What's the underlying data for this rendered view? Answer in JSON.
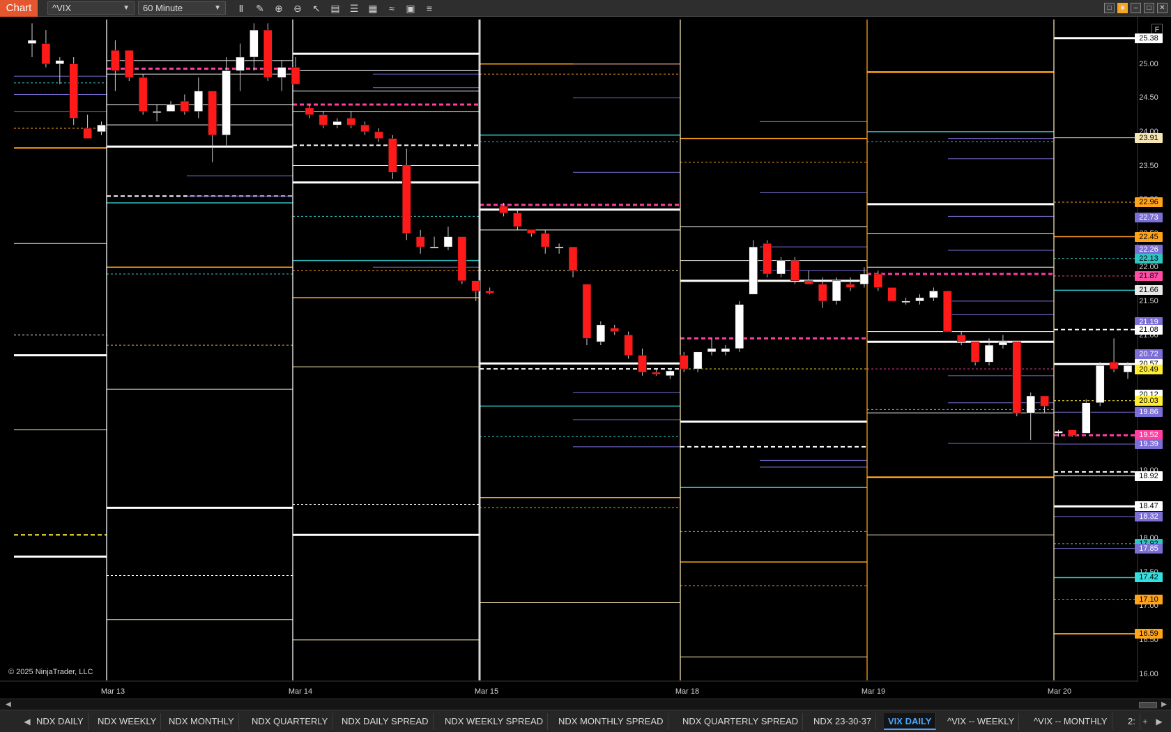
{
  "toolbar": {
    "chart_tab": "Chart",
    "symbol": "^VIX",
    "interval": "60 Minute",
    "icons": [
      "bar-type-icon",
      "drawing-tools-icon",
      "zoom-in-icon",
      "zoom-out-icon",
      "pointer-icon",
      "data-box-icon",
      "properties-icon",
      "strategies-icon",
      "indicators-icon",
      "templates-icon",
      "list-icon"
    ]
  },
  "window_controls": [
    "restore-icon",
    "tile-icon",
    "minimize-icon",
    "maximize-icon",
    "close-icon"
  ],
  "copyright": "© 2025 NinjaTrader, LLC",
  "axis": {
    "f_badge": "F",
    "prices": [
      "25.00",
      "24.50",
      "24.00",
      "23.50",
      "23.00",
      "22.50",
      "22.00",
      "21.50",
      "21.00",
      "20.50",
      "20.00",
      "19.50",
      "19.00",
      "18.50",
      "18.00",
      "17.50",
      "17.00",
      "16.50",
      "16.00"
    ],
    "badges": [
      {
        "value": "25.38",
        "bg": "#ffffff",
        "fg": "#000000"
      },
      {
        "value": "23.91",
        "bg": "#f5e6b3",
        "fg": "#000000"
      },
      {
        "value": "22.96",
        "bg": "#ffa31a",
        "fg": "#000000"
      },
      {
        "value": "22.73",
        "bg": "#7b6fd6",
        "fg": "#ffffff"
      },
      {
        "value": "22.45",
        "bg": "#ffa31a",
        "fg": "#000000"
      },
      {
        "value": "22.26",
        "bg": "#7b6fd6",
        "fg": "#ffffff"
      },
      {
        "value": "22.13",
        "bg": "#2ec4c4",
        "fg": "#000000"
      },
      {
        "value": "21.87",
        "bg": "#ff4da6",
        "fg": "#000000"
      },
      {
        "value": "21.66",
        "bg": "#e8e8e8",
        "fg": "#000000"
      },
      {
        "value": "21.19",
        "bg": "#7b6fd6",
        "fg": "#ffffff"
      },
      {
        "value": "21.08",
        "bg": "#ffffff",
        "fg": "#000000"
      },
      {
        "value": "20.72",
        "bg": "#7b6fd6",
        "fg": "#ffffff"
      },
      {
        "value": "20.57",
        "bg": "#ffffff",
        "fg": "#000000"
      },
      {
        "value": "20.49",
        "bg": "#ffee33",
        "fg": "#000000"
      },
      {
        "value": "20.12",
        "bg": "#ffffff",
        "fg": "#000000"
      },
      {
        "value": "20.03",
        "bg": "#ffee33",
        "fg": "#000000"
      },
      {
        "value": "19.86",
        "bg": "#7b6fd6",
        "fg": "#ffffff"
      },
      {
        "value": "19.52",
        "bg": "#ff3fa0",
        "fg": "#ffffff"
      },
      {
        "value": "19.39",
        "bg": "#7b6fd6",
        "fg": "#ffffff"
      },
      {
        "value": "18.92",
        "bg": "#ffffff",
        "fg": "#000000"
      },
      {
        "value": "18.47",
        "bg": "#ffffff",
        "fg": "#000000"
      },
      {
        "value": "18.32",
        "bg": "#7b6fd6",
        "fg": "#ffffff"
      },
      {
        "value": "17.92",
        "bg": "#2ec4c4",
        "fg": "#000000"
      },
      {
        "value": "17.85",
        "bg": "#7b6fd6",
        "fg": "#ffffff"
      },
      {
        "value": "17.42",
        "bg": "#33e0e0",
        "fg": "#000000"
      },
      {
        "value": "17.10",
        "bg": "#ffa31a",
        "fg": "#000000"
      },
      {
        "value": "16.59",
        "bg": "#ffa31a",
        "fg": "#000000"
      }
    ]
  },
  "dates": [
    "Mar 13",
    "Mar 14",
    "Mar 15",
    "Mar 18",
    "Mar 19",
    "Mar 20"
  ],
  "tabs": [
    "NDX DAILY",
    "NDX WEEKLY",
    "NDX MONTHLY",
    "NDX QUARTERLY",
    "NDX DAILY SPREAD",
    "NDX WEEKLY SPREAD",
    "NDX MONTHLY SPREAD",
    "NDX QUARTERLY SPREAD",
    "NDX 23-30-37",
    "VIX DAILY",
    "^VIX -- WEEKLY",
    "^VIX -- MONTHLY",
    "2:"
  ],
  "active_tab": "VIX DAILY",
  "colors": {
    "up_candle": "#ffffff",
    "down_candle": "#ff1a1a",
    "level_white": "#ffffff",
    "level_purple": "#7b6fd6",
    "level_orange": "#ffa31a",
    "level_cyan": "#2ec4c4",
    "level_pink": "#ff3fa0",
    "level_yellow": "#ffee33",
    "level_cream": "#f5e6b3"
  },
  "chart_data": {
    "type": "candlestick",
    "symbol": "^VIX",
    "interval": "60 Minute",
    "ylim": [
      15.95,
      25.6
    ],
    "x_categories": [
      "Mar 13",
      "Mar 14",
      "Mar 15",
      "Mar 18",
      "Mar 19",
      "Mar 20"
    ],
    "candles": [
      {
        "o": 25.3,
        "h": 25.6,
        "l": 25.1,
        "c": 25.35
      },
      {
        "o": 25.3,
        "h": 25.5,
        "l": 24.95,
        "c": 25.0
      },
      {
        "o": 25.0,
        "h": 25.1,
        "l": 24.7,
        "c": 25.05
      },
      {
        "o": 25.0,
        "h": 25.1,
        "l": 24.1,
        "c": 24.2
      },
      {
        "o": 24.05,
        "h": 24.25,
        "l": 23.9,
        "c": 23.9
      },
      {
        "o": 24.0,
        "h": 24.15,
        "l": 23.95,
        "c": 24.1
      },
      {
        "o": 25.2,
        "h": 25.35,
        "l": 24.6,
        "c": 24.9
      },
      {
        "o": 25.2,
        "h": 25.2,
        "l": 24.75,
        "c": 24.8
      },
      {
        "o": 24.8,
        "h": 24.85,
        "l": 24.25,
        "c": 24.3
      },
      {
        "o": 24.3,
        "h": 24.4,
        "l": 24.15,
        "c": 24.3
      },
      {
        "o": 24.3,
        "h": 24.45,
        "l": 24.3,
        "c": 24.4
      },
      {
        "o": 24.45,
        "h": 24.55,
        "l": 24.25,
        "c": 24.3
      },
      {
        "o": 24.3,
        "h": 24.8,
        "l": 24.2,
        "c": 24.6
      },
      {
        "o": 24.6,
        "h": 24.6,
        "l": 23.55,
        "c": 23.95
      },
      {
        "o": 23.95,
        "h": 25.1,
        "l": 23.8,
        "c": 24.9
      },
      {
        "o": 24.9,
        "h": 25.3,
        "l": 24.6,
        "c": 25.1
      },
      {
        "o": 25.1,
        "h": 25.6,
        "l": 24.9,
        "c": 25.5
      },
      {
        "o": 25.5,
        "h": 25.6,
        "l": 24.75,
        "c": 24.8
      },
      {
        "o": 24.8,
        "h": 25.05,
        "l": 24.6,
        "c": 24.95
      },
      {
        "o": 24.95,
        "h": 25.1,
        "l": 24.7,
        "c": 24.7
      },
      {
        "o": 24.35,
        "h": 24.4,
        "l": 24.2,
        "c": 24.25
      },
      {
        "o": 24.25,
        "h": 24.3,
        "l": 24.05,
        "c": 24.1
      },
      {
        "o": 24.1,
        "h": 24.2,
        "l": 24.05,
        "c": 24.15
      },
      {
        "o": 24.2,
        "h": 24.3,
        "l": 24.05,
        "c": 24.1
      },
      {
        "o": 24.1,
        "h": 24.15,
        "l": 23.95,
        "c": 24.0
      },
      {
        "o": 24.0,
        "h": 24.05,
        "l": 23.85,
        "c": 23.9
      },
      {
        "o": 23.9,
        "h": 23.95,
        "l": 23.3,
        "c": 23.4
      },
      {
        "o": 23.5,
        "h": 23.75,
        "l": 22.4,
        "c": 22.5
      },
      {
        "o": 22.45,
        "h": 22.55,
        "l": 22.2,
        "c": 22.3
      },
      {
        "o": 22.3,
        "h": 22.45,
        "l": 22.3,
        "c": 22.3
      },
      {
        "o": 22.3,
        "h": 22.6,
        "l": 22.25,
        "c": 22.45
      },
      {
        "o": 22.45,
        "h": 22.45,
        "l": 21.75,
        "c": 21.8
      },
      {
        "o": 21.8,
        "h": 21.8,
        "l": 21.5,
        "c": 21.65
      },
      {
        "o": 21.65,
        "h": 21.7,
        "l": 21.6,
        "c": 21.62
      },
      {
        "o": 22.9,
        "h": 22.95,
        "l": 22.75,
        "c": 22.8
      },
      {
        "o": 22.8,
        "h": 22.85,
        "l": 22.55,
        "c": 22.6
      },
      {
        "o": 22.55,
        "h": 22.55,
        "l": 22.45,
        "c": 22.5
      },
      {
        "o": 22.5,
        "h": 22.55,
        "l": 22.2,
        "c": 22.3
      },
      {
        "o": 22.3,
        "h": 22.35,
        "l": 22.2,
        "c": 22.3
      },
      {
        "o": 22.3,
        "h": 22.3,
        "l": 21.85,
        "c": 21.95
      },
      {
        "o": 21.75,
        "h": 21.75,
        "l": 20.85,
        "c": 20.95
      },
      {
        "o": 20.9,
        "h": 21.2,
        "l": 20.85,
        "c": 21.15
      },
      {
        "o": 21.1,
        "h": 21.15,
        "l": 21.0,
        "c": 21.05
      },
      {
        "o": 21.0,
        "h": 21.05,
        "l": 20.65,
        "c": 20.7
      },
      {
        "o": 20.7,
        "h": 20.8,
        "l": 20.4,
        "c": 20.45
      },
      {
        "o": 20.45,
        "h": 20.5,
        "l": 20.4,
        "c": 20.42
      },
      {
        "o": 20.4,
        "h": 20.5,
        "l": 20.35,
        "c": 20.47
      },
      {
        "o": 20.7,
        "h": 20.75,
        "l": 20.45,
        "c": 20.5
      },
      {
        "o": 20.5,
        "h": 20.75,
        "l": 20.45,
        "c": 20.75
      },
      {
        "o": 20.75,
        "h": 20.95,
        "l": 20.7,
        "c": 20.8
      },
      {
        "o": 20.75,
        "h": 20.85,
        "l": 20.7,
        "c": 20.8
      },
      {
        "o": 20.8,
        "h": 21.5,
        "l": 20.75,
        "c": 21.45
      },
      {
        "o": 21.6,
        "h": 22.4,
        "l": 21.6,
        "c": 22.3
      },
      {
        "o": 22.35,
        "h": 22.4,
        "l": 21.85,
        "c": 21.9
      },
      {
        "o": 21.9,
        "h": 22.15,
        "l": 21.85,
        "c": 22.1
      },
      {
        "o": 22.1,
        "h": 22.15,
        "l": 21.75,
        "c": 21.8
      },
      {
        "o": 21.8,
        "h": 21.95,
        "l": 21.75,
        "c": 21.75
      },
      {
        "o": 21.75,
        "h": 21.85,
        "l": 21.4,
        "c": 21.5
      },
      {
        "o": 21.5,
        "h": 21.85,
        "l": 21.45,
        "c": 21.8
      },
      {
        "o": 21.75,
        "h": 21.85,
        "l": 21.65,
        "c": 21.7
      },
      {
        "o": 21.75,
        "h": 22.0,
        "l": 21.7,
        "c": 21.9
      },
      {
        "o": 21.9,
        "h": 21.95,
        "l": 21.65,
        "c": 21.7
      },
      {
        "o": 21.7,
        "h": 21.7,
        "l": 21.5,
        "c": 21.5
      },
      {
        "o": 21.5,
        "h": 21.55,
        "l": 21.45,
        "c": 21.5
      },
      {
        "o": 21.5,
        "h": 21.6,
        "l": 21.45,
        "c": 21.55
      },
      {
        "o": 21.55,
        "h": 21.7,
        "l": 21.5,
        "c": 21.65
      },
      {
        "o": 21.65,
        "h": 21.65,
        "l": 21.05,
        "c": 21.05
      },
      {
        "o": 21.0,
        "h": 21.05,
        "l": 20.85,
        "c": 20.9
      },
      {
        "o": 20.9,
        "h": 20.9,
        "l": 20.55,
        "c": 20.6
      },
      {
        "o": 20.6,
        "h": 20.95,
        "l": 20.55,
        "c": 20.85
      },
      {
        "o": 20.85,
        "h": 21.0,
        "l": 20.8,
        "c": 20.9
      },
      {
        "o": 20.9,
        "h": 20.9,
        "l": 19.8,
        "c": 19.85
      },
      {
        "o": 19.85,
        "h": 20.15,
        "l": 19.45,
        "c": 20.1
      },
      {
        "o": 20.1,
        "h": 20.1,
        "l": 19.85,
        "c": 19.95
      },
      {
        "o": 19.55,
        "h": 19.6,
        "l": 19.5,
        "c": 19.58
      },
      {
        "o": 19.6,
        "h": 19.6,
        "l": 19.5,
        "c": 19.52
      },
      {
        "o": 19.55,
        "h": 20.05,
        "l": 19.55,
        "c": 20.0
      },
      {
        "o": 20.0,
        "h": 20.6,
        "l": 19.95,
        "c": 20.55
      },
      {
        "o": 20.6,
        "h": 20.95,
        "l": 20.45,
        "c": 20.5
      },
      {
        "o": 20.45,
        "h": 20.6,
        "l": 20.35,
        "c": 20.55
      }
    ]
  }
}
